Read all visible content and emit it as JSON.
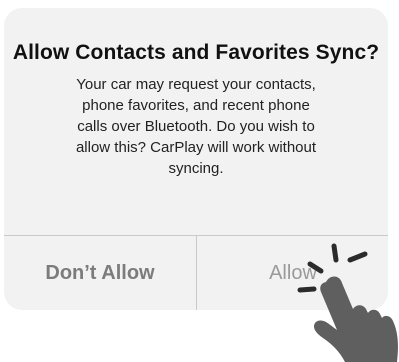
{
  "dialog": {
    "title": "Allow Contacts and Favorites Sync?",
    "message": "Your car may request your contacts,\nphone favorites, and recent phone\ncalls over Bluetooth. Do you wish to\nallow this? CarPlay will work without\nsyncing.",
    "buttons": {
      "dont_allow": "Don’t Allow",
      "allow": "Allow"
    }
  },
  "overlay": {
    "icon": "tap-hand-icon"
  }
}
